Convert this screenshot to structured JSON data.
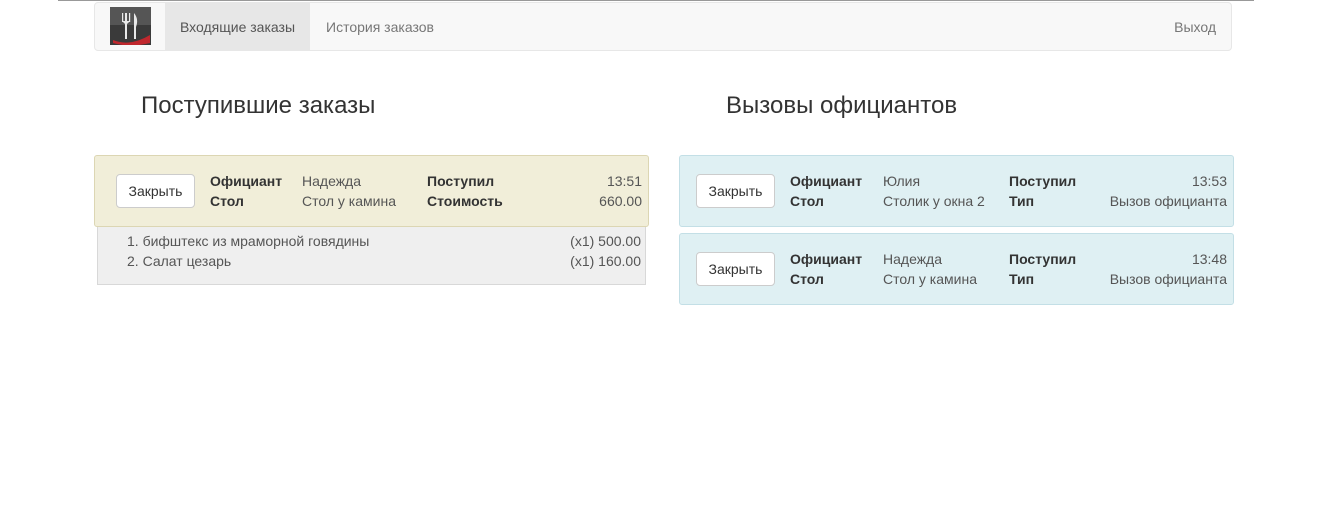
{
  "navbar": {
    "tabs": [
      {
        "label": "Входящие заказы",
        "active": true
      },
      {
        "label": "История заказов",
        "active": false
      }
    ],
    "logout_label": "Выход"
  },
  "sections": {
    "orders_title": "Поступившие заказы",
    "calls_title": "Вызовы официантов"
  },
  "order": {
    "close_label": "Закрыть",
    "waiter_label": "Официант",
    "waiter": "Надежда",
    "table_label": "Стол",
    "table": "Стол у камина",
    "received_label": "Поступил",
    "received": "13:51",
    "cost_label": "Стоимость",
    "cost": "660.00",
    "items": [
      {
        "name": "1. бифштекс из мраморной говядины",
        "price": "(x1) 500.00"
      },
      {
        "name": "2. Салат цезарь",
        "price": "(x1) 160.00"
      }
    ]
  },
  "calls": [
    {
      "close_label": "Закрыть",
      "waiter_label": "Официант",
      "waiter": "Юлия",
      "table_label": "Стол",
      "table": "Столик у окна 2",
      "received_label": "Поступил",
      "received": "13:53",
      "type_label": "Тип",
      "type": "Вызов официанта"
    },
    {
      "close_label": "Закрыть",
      "waiter_label": "Официант",
      "waiter": "Надежда",
      "table_label": "Стол",
      "table": "Стол у камина",
      "received_label": "Поступил",
      "received": "13:48",
      "type_label": "Тип",
      "type": "Вызов официанта"
    }
  ],
  "colors": {
    "order_card_bg": "#f1eed9",
    "call_card_bg": "#dff0f3",
    "navbar_bg": "#f8f8f8",
    "brand_accent": "#c0272d"
  },
  "icons": {
    "brand": "fork-knife-logo-icon"
  }
}
